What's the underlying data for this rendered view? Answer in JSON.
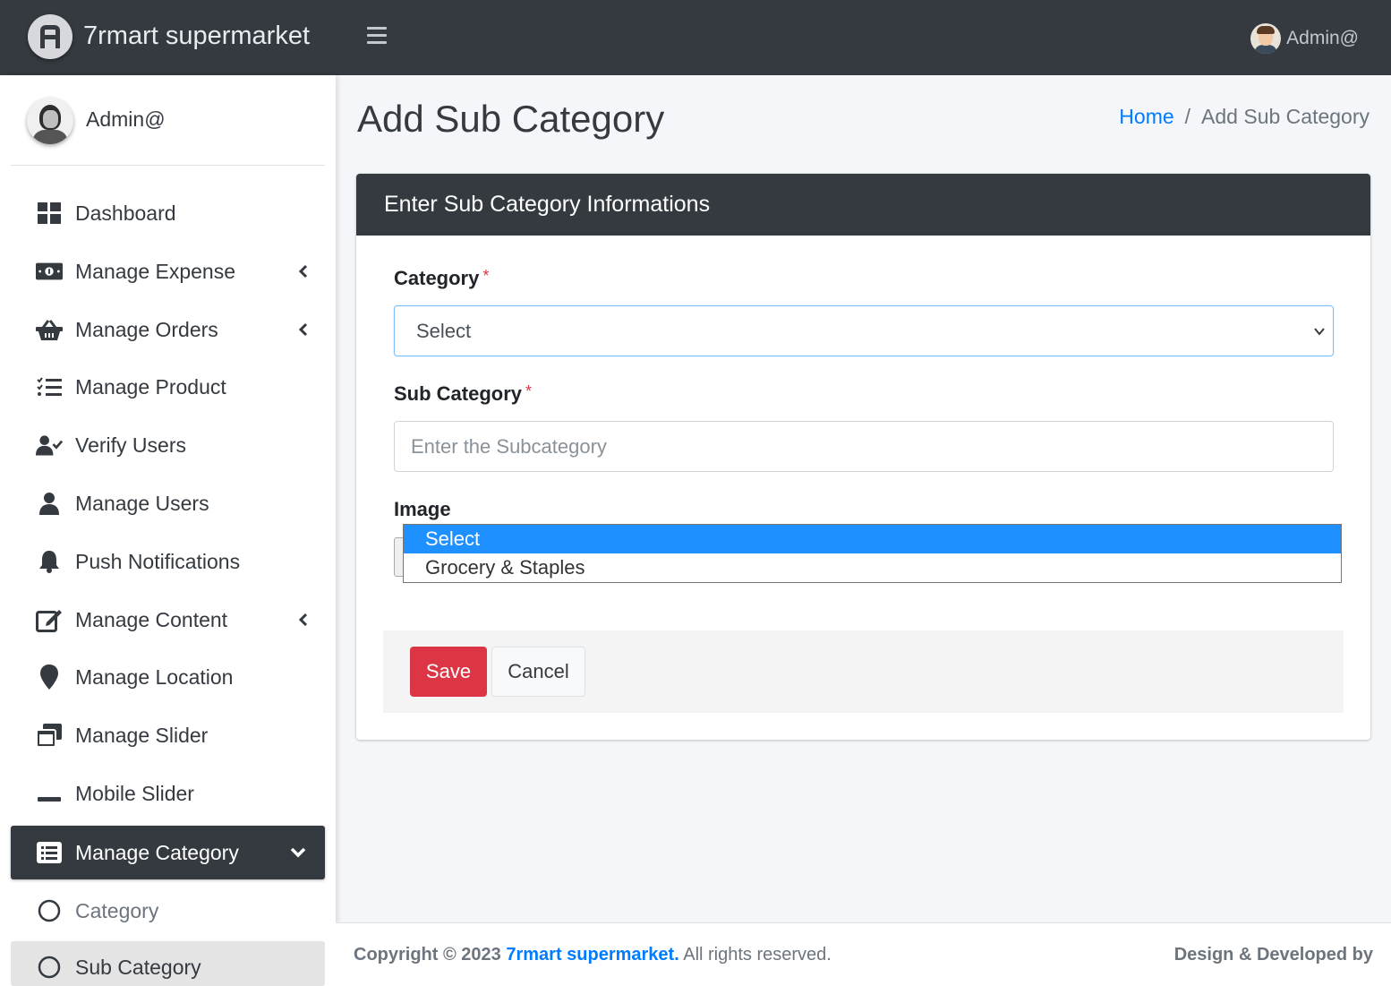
{
  "brand": {
    "name": "7rmart supermarket"
  },
  "topbar": {
    "user_name": "Admin@"
  },
  "sidebar": {
    "user_name": "Admin@",
    "items": [
      {
        "label": "Dashboard",
        "icon": "dashboard-icon"
      },
      {
        "label": "Manage Expense",
        "icon": "money-bill-icon",
        "has_submenu": true
      },
      {
        "label": "Manage Orders",
        "icon": "basket-icon",
        "has_submenu": true
      },
      {
        "label": "Manage Product",
        "icon": "list-check-icon"
      },
      {
        "label": "Verify Users",
        "icon": "user-check-icon"
      },
      {
        "label": "Manage Users",
        "icon": "user-icon"
      },
      {
        "label": "Push Notifications",
        "icon": "bell-icon"
      },
      {
        "label": "Manage Content",
        "icon": "edit-icon",
        "has_submenu": true
      },
      {
        "label": "Manage Location",
        "icon": "map-marker-icon"
      },
      {
        "label": "Manage Slider",
        "icon": "window-restore-icon"
      },
      {
        "label": "Mobile Slider",
        "icon": "minus-icon"
      },
      {
        "label": "Manage Category",
        "icon": "list-alt-icon",
        "has_submenu": true,
        "expanded": true
      },
      {
        "label": "Category",
        "icon": "circle-icon"
      },
      {
        "label": "Sub Category",
        "icon": "circle-icon",
        "active": true
      }
    ]
  },
  "page": {
    "title": "Add Sub Category",
    "breadcrumb": {
      "home": "Home",
      "separator": "/",
      "current": "Add Sub Category"
    }
  },
  "card": {
    "title": "Enter Sub Category Informations",
    "category_label": "Category",
    "category_value": "Select",
    "subcategory_label": "Sub Category",
    "subcategory_placeholder": "Enter the Subcategory",
    "required_mark": "*",
    "image_label": "Image",
    "dropdown_options": [
      "Select",
      "Grocery & Staples"
    ],
    "save_label": "Save",
    "cancel_label": "Cancel"
  },
  "footer": {
    "copyright_prefix": "Copyright © 2023",
    "brand_link": "7rmart supermarket.",
    "rights": "All rights reserved.",
    "right_text": "Design & Developed by"
  },
  "colors": {
    "dark": "#343a40",
    "primary": "#007bff",
    "danger": "#dc3545",
    "dropdown_highlight": "#1e90ff"
  }
}
